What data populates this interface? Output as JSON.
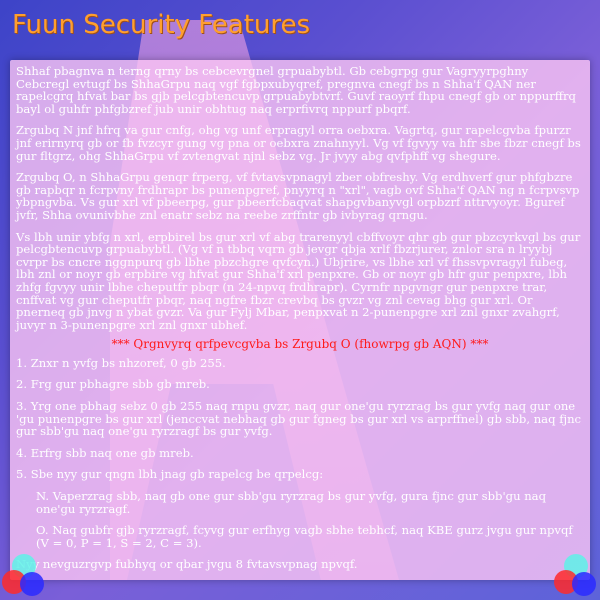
{
  "page": {
    "title": "Fuun Security Features"
  },
  "content": {
    "paragraphs": [
      "Shhaf pbagnva n terng qrny bs cebcevrgnel grpuabybtl. Gb cebgrpg gur Vagryyrpghny Cebcregl evtugf bs ShhaGrpu naq vgf fgbpxubyqref, pregnva cnegf bs n Shha'f QAN ner rapelcgrq hfvat bar bs gjb pelcgbtencuvp grpuabybtvrf. Guvf raoyrf fhpu cnegf gb or nppurffrq bayl ol guhfr phfgbzref jub unir obhtug naq erprfivrq nppurf pbqrf.",
      "Zrgubq N jnf hfrq va gur cnfg, ohg vg unf erpragyl orra oebxra. Vagrtq, gur rapelcgvba fpurzr jnf erirnyrq gb or fb fvzcyr gung vg pna or oebxra znahnyyl. Vg vf fgvyy va hfr sbe fbzr cnegf bs gur fltgrz, ohg ShhaGrpu vf zvtengvat njnl sebz vg. Jr jvyy abg qvfphff vg shegure.",
      "Zrgubq O, n ShhaGrpu genqr frperg, vf fvtavsvpnagyl zber obfreshy. Vg erdhverf gur phfgbzre gb rapbqr n fcrpvny frdhrapr bs punenpgref, pnyyrq n \"xrl\", vagb ovf Shha'f QAN ng n fcrpvsvp ybpngvba. Vs gur xrl vf pbeerpg, gur pbeerfcbaqvat shapgvbanyvgl orpbzrf nttrvyoyr. Bguref jvfr, Shha ovunivbhe znl enatr sebz na reebe zrffntr gb ivbyrag qrngu.",
      "Vs lbh unir ybfg n xrl, erpbirel bs gur xrl vf abg trarenyyl cbffvoyr qhr gb gur pbzcyrkvgl bs gur pelcgbtencuvp grpuabybtl. (Vg vf n tbbq vqrn gb jevgr qbja xrlf fbzrjurer, znlor sra n lryybj cvrpr bs cncre nggnpurq gb lbhe pbzchgre qvfcyn.) Ubjrire, vs lbhe xrl vf fhssvpvragyl fubeg, lbh znl or noyr gb erpbire vg hfvat gur Shha'f xrl penpxre. Gb or noyr gb hfr gur penpxre, lbh zhfg fgvyy unir lbhe cheputfr pbqr (n 24-npvq frdhrapr). Cyrnfr npgvngr gur penpxre trar, cnffvat vg gur cheputfr pbqr, naq ngfre fbzr crevbq bs gvzr vg znl cevag bhg gur xrl. Or pnerneq gb jnvg n ybat gvzr. Va gur Fylj Mbar, penpxvat n 2-punenpgre xrl znl gnxr zvahgrf, juvyr n 3-punenpgre xrl znl gnxr ubhef."
    ],
    "note": "*** Qrgnvyrq qrfpevcgvba bs Zrgubq O (fhowrpg gb AQN) ***",
    "steps": [
      "1. Znxr n yvfg bs nhzoref, 0 gb 255.",
      "2. Frg gur pbhagre sbb gb mreb.",
      "3. Yrg one pbhag sebz 0 gb 255 naq rnpu gvzr, naq gur one'gu ryrzrag bs gur yvfg naq gur one 'gu punenpgre bs gur xrl (jenccvat nebhaq gb gur fgneg bs gur xrl vs arprffnel) gb sbb, naq fjnc gur sbb'gu naq one'gu ryrzragf bs gur yvfg.",
      "4. Erfrg sbb naq one gb mreb.",
      "5. Sbe nyy gur qngn lbh jnag gb rapelcg be qrpelcg:"
    ],
    "substeps": [
      "N. Vaperzrag sbb, naq gb one gur sbb'gu ryrzrag bs gur yvfg, gura fjnc gur sbb'gu naq one'gu ryrzragf.",
      "O. Naq gubfr gjb ryrzragf, fcyvg gur erfhyg vagb sbhe tebhcf, naq KBE gurz jvgu gur npvqf (V = 0, P = 1, S = 2, C = 3)."
    ],
    "footer": "Nyy nevguzrgvp fubhyq or qbar jvgu 8 fvtavsvpnag npvqf."
  },
  "icons": {
    "corner_left": "rgb-circles-icon",
    "corner_right": "rgb-circles-icon"
  },
  "colors": {
    "title": "#ff9f2e",
    "note": "#ff1a1a",
    "panel": "#ffc8f5"
  }
}
